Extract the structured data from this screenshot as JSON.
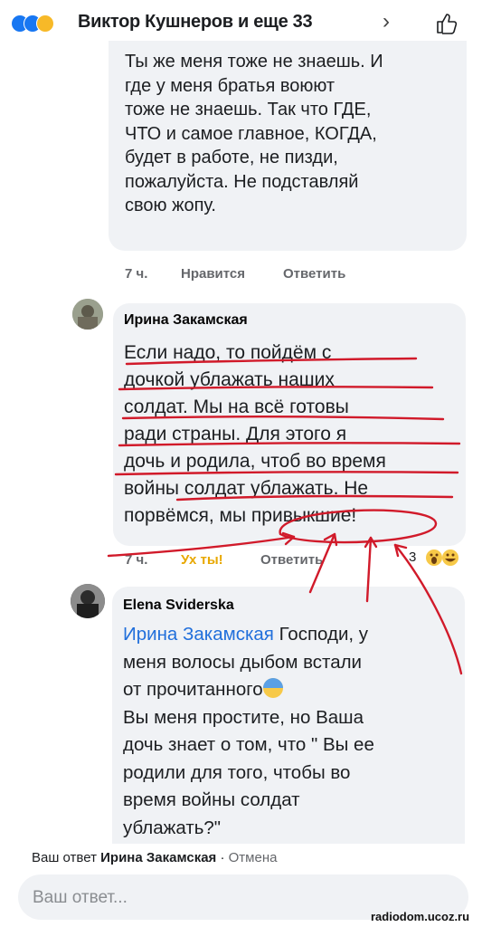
{
  "header": {
    "title": "Виктор Кушнеров и еще 33",
    "chevron": "›"
  },
  "comment1": {
    "lines": [
      "Ты же меня тоже не знаешь. И",
      "где у меня братья воюют",
      "тоже не  знаешь.  Так что ГДЕ,",
      "ЧТО и самое главное, КОГДА,",
      "будет  в работе, не пизди,",
      "пожалуйста. Не подставляй",
      "свою жопу."
    ],
    "time": "7 ч.",
    "like": "Нравится",
    "reply": "Ответить"
  },
  "comment2": {
    "author": "Ирина Закамская",
    "lines": [
      "Если надо, то пойдём с",
      "дочкой ублажать наших",
      "солдат. Мы на всё готовы",
      "ради  страны. Для этого я",
      "дочь и родила, чтоб во время",
      "войны солдат ублажать. Не",
      "порвёмся, мы привыкшие!"
    ],
    "time": "7 ч.",
    "reaction": "Ух ты!",
    "reply": "Ответить",
    "reaction_count": "3"
  },
  "comment3": {
    "author": "Elena Sviderska",
    "mention": "Ирина Закамская",
    "line1_rest": " Господи, у",
    "lines": [
      "меня волосы дыбом встали",
      "от прочитанного",
      "Вы меня простите, но Ваша",
      "дочь знает о том, что \" Вы ее",
      "родили для того, чтобы во",
      "время войны солдат",
      "ублажать?\""
    ]
  },
  "reply_bar": {
    "prefix": "Ваш ответ ",
    "target": "Ирина Закамская",
    "separator": " · ",
    "cancel": "Отмена",
    "placeholder": "Ваш ответ..."
  },
  "watermark": "radiodom.ucoz.ru",
  "colors": {
    "bubble": "#f0f2f5",
    "mention": "#216fdb",
    "wow": "#e8a800",
    "ink": "#d11a2a"
  }
}
